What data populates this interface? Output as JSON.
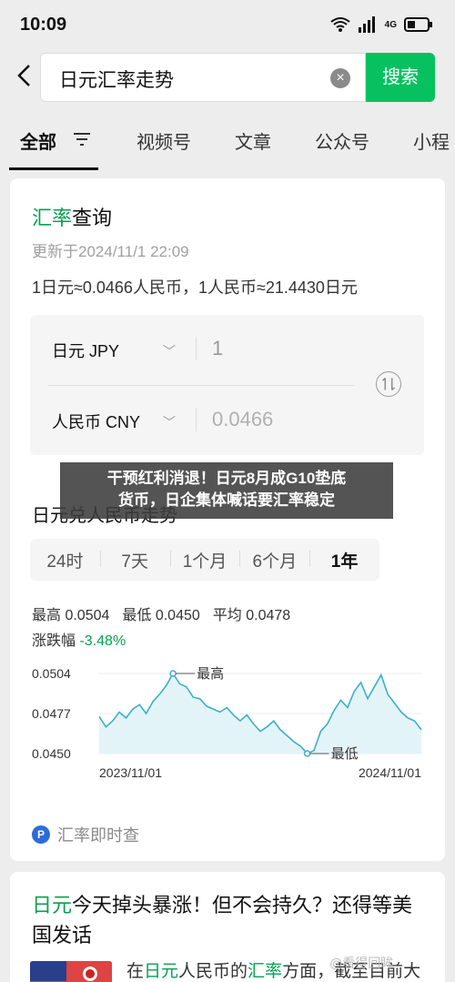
{
  "status": {
    "time": "10:09",
    "network_label": "4G"
  },
  "search": {
    "query": "日元汇率走势",
    "button": "搜索"
  },
  "tabs": [
    "全部",
    "视频号",
    "文章",
    "公众号",
    "小程"
  ],
  "rate_card": {
    "title_green": "汇率",
    "title_rest": "查询",
    "updated": "更新于2024/11/1 22:09",
    "rates_line": "1日元≈0.0466人民币，1人民币≈21.4430日元",
    "from_currency": "日元 JPY",
    "from_amount": "1",
    "to_currency": "人民币 CNY",
    "to_amount": "0.0466",
    "trend_title": "日元兑人民币走势",
    "periods": [
      "24时",
      "7天",
      "1个月",
      "6个月",
      "1年"
    ],
    "active_period": "1年",
    "stats": {
      "high": "最高 0.0504",
      "low": "最低 0.0450",
      "avg": "平均 0.0478"
    },
    "change_label": "涨跌幅",
    "change_value": "-3.48%",
    "footer": "汇率即时查"
  },
  "chart_data": {
    "type": "line",
    "title": "",
    "x_start": "2023/11/01",
    "x_end": "2024/11/01",
    "yticks": [
      "0.0504",
      "0.0477",
      "0.0450"
    ],
    "ylim": [
      0.045,
      0.0504
    ],
    "high_label": "最高",
    "low_label": "最低",
    "values": [
      0.0475,
      0.0468,
      0.0472,
      0.0478,
      0.0474,
      0.048,
      0.0483,
      0.0477,
      0.0485,
      0.049,
      0.0496,
      0.0504,
      0.0497,
      0.0495,
      0.0488,
      0.0487,
      0.0482,
      0.048,
      0.0478,
      0.0481,
      0.0476,
      0.0472,
      0.0476,
      0.047,
      0.0465,
      0.0468,
      0.0472,
      0.0466,
      0.0462,
      0.0458,
      0.0455,
      0.045,
      0.0452,
      0.0465,
      0.047,
      0.0479,
      0.0486,
      0.0481,
      0.0492,
      0.0498,
      0.0487,
      0.0495,
      0.0503,
      0.049,
      0.0484,
      0.0478,
      0.0474,
      0.0472,
      0.0466
    ],
    "colors": {
      "line": "#3cb0c8",
      "fill": "#e3f4f8"
    }
  },
  "overlay": {
    "line1": "干预红利消退！日元8月成G10垫底",
    "line2": "货币，日企集体喊话要汇率稳定"
  },
  "article": {
    "title_green": "日元",
    "title_rest": "今天掉头暴涨！但不会持久？还得等美国发话",
    "snippet_pre": "在",
    "snippet_g1": "日元",
    "snippet_mid": "人民币的",
    "snippet_g2": "汇率",
    "snippet_post": "方面，截至目前大"
  },
  "watermark": "@看得回眸"
}
